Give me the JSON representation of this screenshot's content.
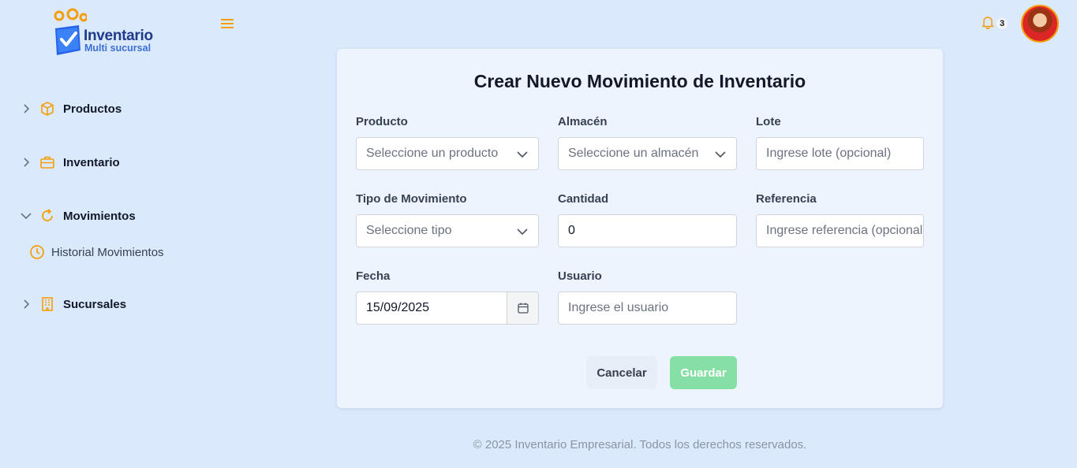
{
  "brand": {
    "title": "Inventario",
    "subtitle": "Multi sucursal"
  },
  "sidebar": {
    "items": [
      {
        "label": "Productos",
        "icon": "box-icon"
      },
      {
        "label": "Inventario",
        "icon": "briefcase-icon"
      },
      {
        "label": "Movimientos",
        "icon": "refresh-icon",
        "expanded": true
      },
      {
        "label": "Sucursales",
        "icon": "building-icon"
      }
    ],
    "subitems": [
      {
        "label": "Historial Movimientos",
        "icon": "clock-icon"
      }
    ]
  },
  "header": {
    "notification_count": "3"
  },
  "form": {
    "title": "Crear Nuevo Movimiento de Inventario",
    "producto": {
      "label": "Producto",
      "placeholder": "Seleccione un producto"
    },
    "almacen": {
      "label": "Almacén",
      "placeholder": "Seleccione un almacén"
    },
    "lote": {
      "label": "Lote",
      "placeholder": "Ingrese lote (opcional)"
    },
    "tipo": {
      "label": "Tipo de Movimiento",
      "placeholder": "Seleccione tipo"
    },
    "cantidad": {
      "label": "Cantidad",
      "value": "0"
    },
    "referencia": {
      "label": "Referencia",
      "placeholder": "Ingrese referencia (opcional)"
    },
    "fecha": {
      "label": "Fecha",
      "value": "15/09/2025"
    },
    "usuario": {
      "label": "Usuario",
      "placeholder": "Ingrese el usuario"
    },
    "cancel_label": "Cancelar",
    "save_label": "Guardar"
  },
  "footer": {
    "text": "© 2025 Inventario Empresarial. Todos los derechos reservados."
  },
  "colors": {
    "accent": "#f59e0b",
    "brand": "#1e3a8a",
    "save": "#86dfa5",
    "background": "#dbe9fc"
  }
}
